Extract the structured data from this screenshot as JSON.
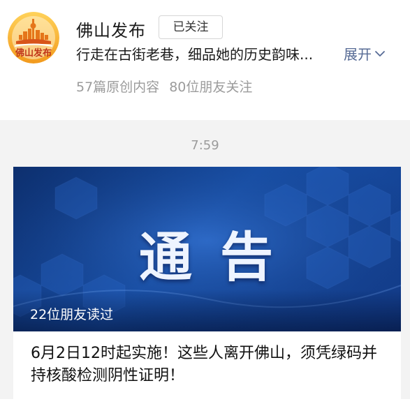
{
  "account": {
    "name": "佛山发布",
    "avatar_text": "佛山发布",
    "follow_label": "已关注",
    "intro": "行走在古街老巷，细品她的历史韵味...",
    "expand_label": "展开",
    "original_count": "57篇原创内容",
    "friends_following": "80位朋友关注"
  },
  "feed": {
    "time": "7:59",
    "article": {
      "cover_title": "通告",
      "read_by_friends": "22位朋友读过",
      "title": "6月2日12时起实施！这些人离开佛山，须凭绿码并持核酸检测阴性证明！"
    }
  },
  "colors": {
    "link": "#576b95",
    "cover_blue": "#1850a8",
    "avatar_orange": "#f5a623"
  }
}
